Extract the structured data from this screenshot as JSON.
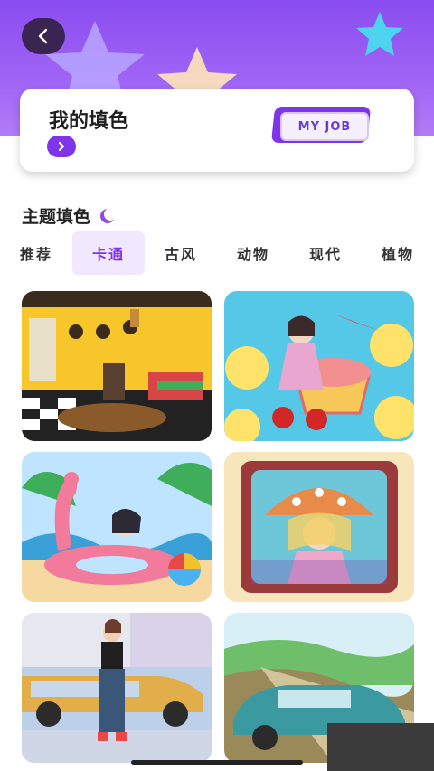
{
  "header": {
    "back_icon": "chevron-left-icon",
    "card": {
      "title": "我的填色",
      "arrow_icon": "chevron-right-icon",
      "badge": "MY JOB"
    }
  },
  "section": {
    "title": "主题填色",
    "decor_icon": "moon-icon"
  },
  "tabs": [
    {
      "label": "推荐",
      "active": false
    },
    {
      "label": "卡通",
      "active": true
    },
    {
      "label": "古风",
      "active": false
    },
    {
      "label": "动物",
      "active": false
    },
    {
      "label": "现代",
      "active": false
    },
    {
      "label": "植物",
      "active": false
    }
  ],
  "gallery": [
    {
      "name": "living-room-illustration"
    },
    {
      "name": "girl-fruit-cup-illustration"
    },
    {
      "name": "flamingo-float-illustration"
    },
    {
      "name": "mushroom-girl-illustration"
    },
    {
      "name": "street-woman-car-illustration"
    },
    {
      "name": "vintage-car-landscape-illustration"
    }
  ],
  "colors": {
    "brand": "#7e34e8",
    "hero_top": "#8a4cf0",
    "tab_active_bg": "#f1e8ff"
  }
}
